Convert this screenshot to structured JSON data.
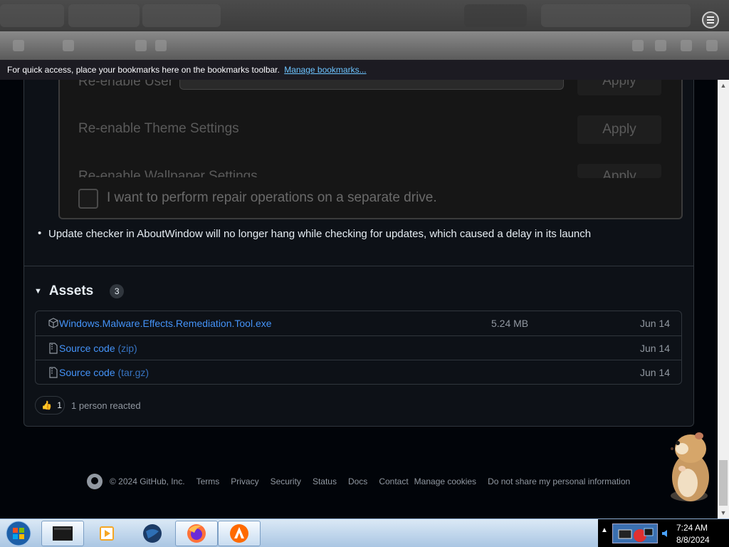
{
  "browser": {
    "bookmarks_bar_text": "For quick access, place your bookmarks here on the bookmarks toolbar.",
    "manage_bookmarks_link": "Manage bookmarks..."
  },
  "dock": {
    "icons": [
      "media-player-icon",
      "globe-download-icon",
      "internet-explorer-icon",
      "mail-icon",
      "users-icon"
    ]
  },
  "repair_panel": {
    "rows": [
      {
        "label": "Re-enable User",
        "apply": "Apply"
      },
      {
        "label": "Re-enable Theme Settings",
        "apply": "Apply"
      },
      {
        "label": "Re-enable Wallpaper Settings",
        "apply": "Apply"
      }
    ],
    "checkbox_label": "I want to perform repair operations on a separate drive."
  },
  "release_notes": {
    "bullet": "Update checker in AboutWindow will no longer hang while checking for updates, which caused a delay in its launch"
  },
  "assets": {
    "title": "Assets",
    "count": "3",
    "items": [
      {
        "name": "Windows.Malware.Effects.Remediation.Tool.exe",
        "suffix": "",
        "size": "5.24 MB",
        "date": "Jun 14",
        "icon": "package-icon"
      },
      {
        "name": "Source code",
        "suffix": "(zip)",
        "size": "",
        "date": "Jun 14",
        "icon": "file-zip-icon"
      },
      {
        "name": "Source code",
        "suffix": "(tar.gz)",
        "size": "",
        "date": "Jun 14",
        "icon": "file-zip-icon"
      }
    ]
  },
  "reactions": {
    "emoji": "👍",
    "count": "1",
    "summary": "1 person reacted"
  },
  "footer": {
    "copyright": "© 2024 GitHub, Inc.",
    "links": [
      "Terms",
      "Privacy",
      "Security",
      "Status",
      "Docs",
      "Contact",
      "Manage cookies",
      "Do not share my personal information"
    ]
  },
  "taskbar": {
    "time": "7:24 AM",
    "date": "8/8/2024"
  },
  "colors": {
    "page_bg": "#0d1117",
    "link": "#4493f8",
    "muted": "#9198a1",
    "border": "#30363d"
  }
}
